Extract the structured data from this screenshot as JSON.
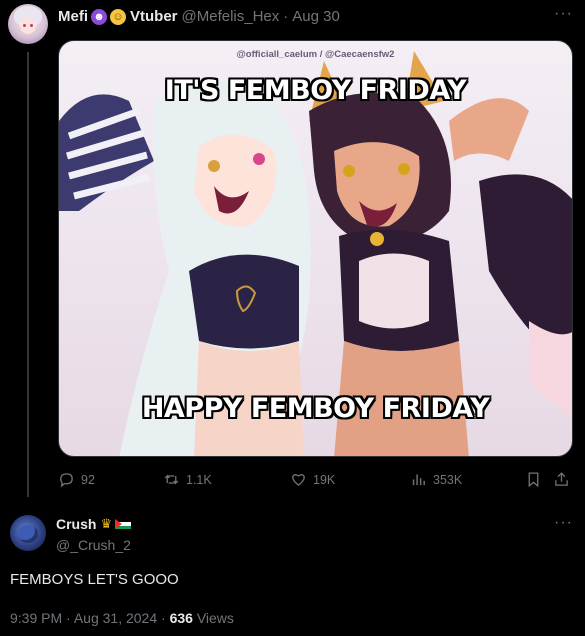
{
  "tweet": {
    "author_name": "Mefi",
    "author_name_suffix": "Vtuber",
    "badges": [
      "devil-emoji",
      "halo-emoji"
    ],
    "handle": "@Mefelis_Hex",
    "separator": "·",
    "date": "Aug 30",
    "more": "···",
    "media": {
      "credit": "@officiall_caelum / @Caecaensfw2",
      "top_text": "IT'S FEMBOY FRIDAY",
      "bottom_text": "HAPPY FEMBOY FRIDAY"
    },
    "actions": {
      "replies": "92",
      "retweets": "1.1K",
      "likes": "19K",
      "views": "353K"
    }
  },
  "reply": {
    "author_name": "Crush",
    "badges": [
      "crown-emoji",
      "palestine-flag-emoji"
    ],
    "handle": "@_Crush_2",
    "more": "···",
    "text": "FEMBOYS LET'S GOOO",
    "time": "9:39 PM",
    "separator": "·",
    "date": "Aug 31, 2024",
    "views_count": "636",
    "views_label": "Views"
  },
  "colors": {
    "background": "#000000",
    "text_primary": "#e7e9ea",
    "text_secondary": "#71767b",
    "divider": "#333639"
  }
}
